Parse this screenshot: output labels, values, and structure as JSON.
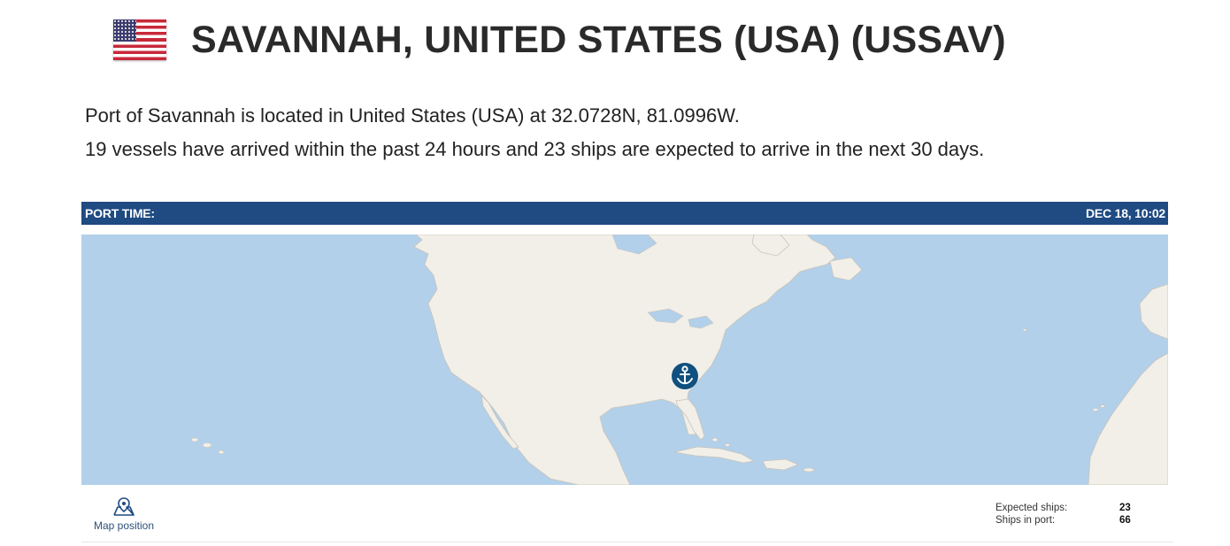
{
  "header": {
    "flag_icon": "us-flag-icon",
    "title": "SAVANNAH, UNITED STATES (USA) (USSAV)"
  },
  "description": {
    "line1": "Port of Savannah is located in United States (USA) at 32.0728N, 81.0996W.",
    "line2": "19 vessels have arrived within the past 24 hours and 23 ships are expected to arrive in the next 30 days."
  },
  "port_time": {
    "label": "PORT TIME:",
    "value": "DEC 18, 10:02"
  },
  "map": {
    "marker_icon": "anchor-icon",
    "colors": {
      "water": "#b2d0ea",
      "land": "#f2efe9",
      "marker": "#0f5080",
      "bar": "#1f4a82"
    }
  },
  "footer": {
    "map_position_icon": "map-pin-icon",
    "map_position_label": "Map position",
    "stats": [
      {
        "label": "Expected ships:",
        "value": "23"
      },
      {
        "label": "Ships in port:",
        "value": "66"
      }
    ]
  }
}
